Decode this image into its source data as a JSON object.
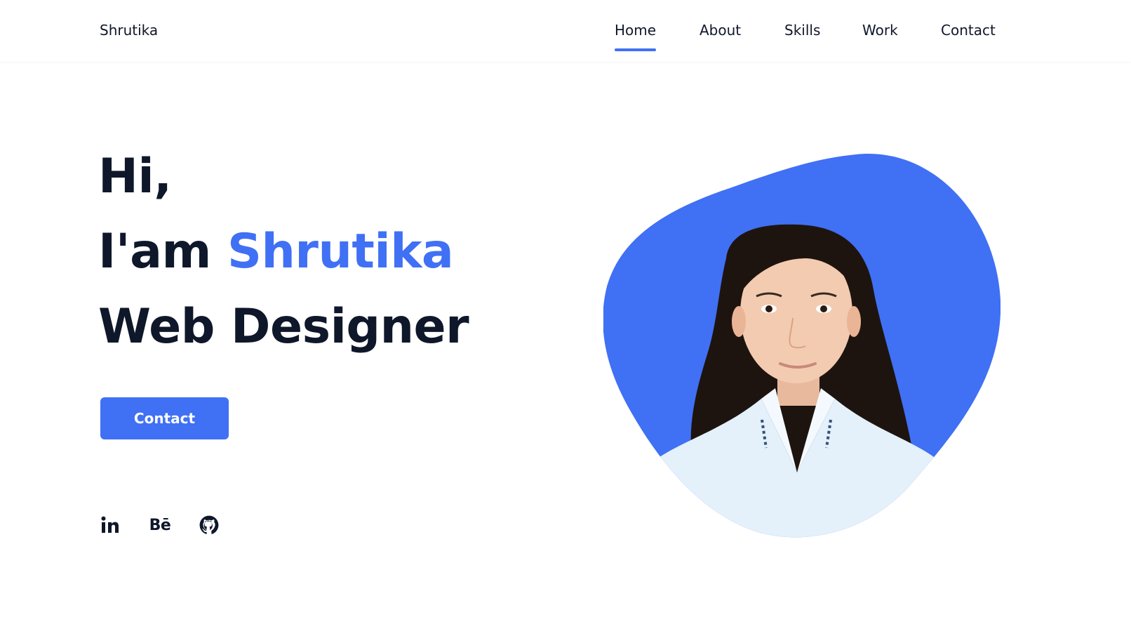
{
  "header": {
    "logo": "Shrutika",
    "nav": [
      {
        "label": "Home",
        "active": true
      },
      {
        "label": "About",
        "active": false
      },
      {
        "label": "Skills",
        "active": false
      },
      {
        "label": "Work",
        "active": false
      },
      {
        "label": "Contact",
        "active": false
      }
    ]
  },
  "hero": {
    "greeting": "Hi,",
    "intro_prefix": "I'am ",
    "name": "Shrutika",
    "role": "Web Designer",
    "cta_label": "Contact",
    "social": [
      {
        "icon": "linkedin-icon"
      },
      {
        "icon": "behance-icon",
        "glyph": "Bē"
      },
      {
        "icon": "github-icon"
      }
    ],
    "portrait": {
      "icon": "profile-photo",
      "alt": "Portrait of Shrutika"
    }
  },
  "colors": {
    "accent": "#4070f4",
    "text": "#0f172a",
    "background": "#ffffff",
    "portrait_skin": "#f3cbb1",
    "portrait_hair": "#1e140f",
    "portrait_shirt": "#e4f0fa"
  }
}
